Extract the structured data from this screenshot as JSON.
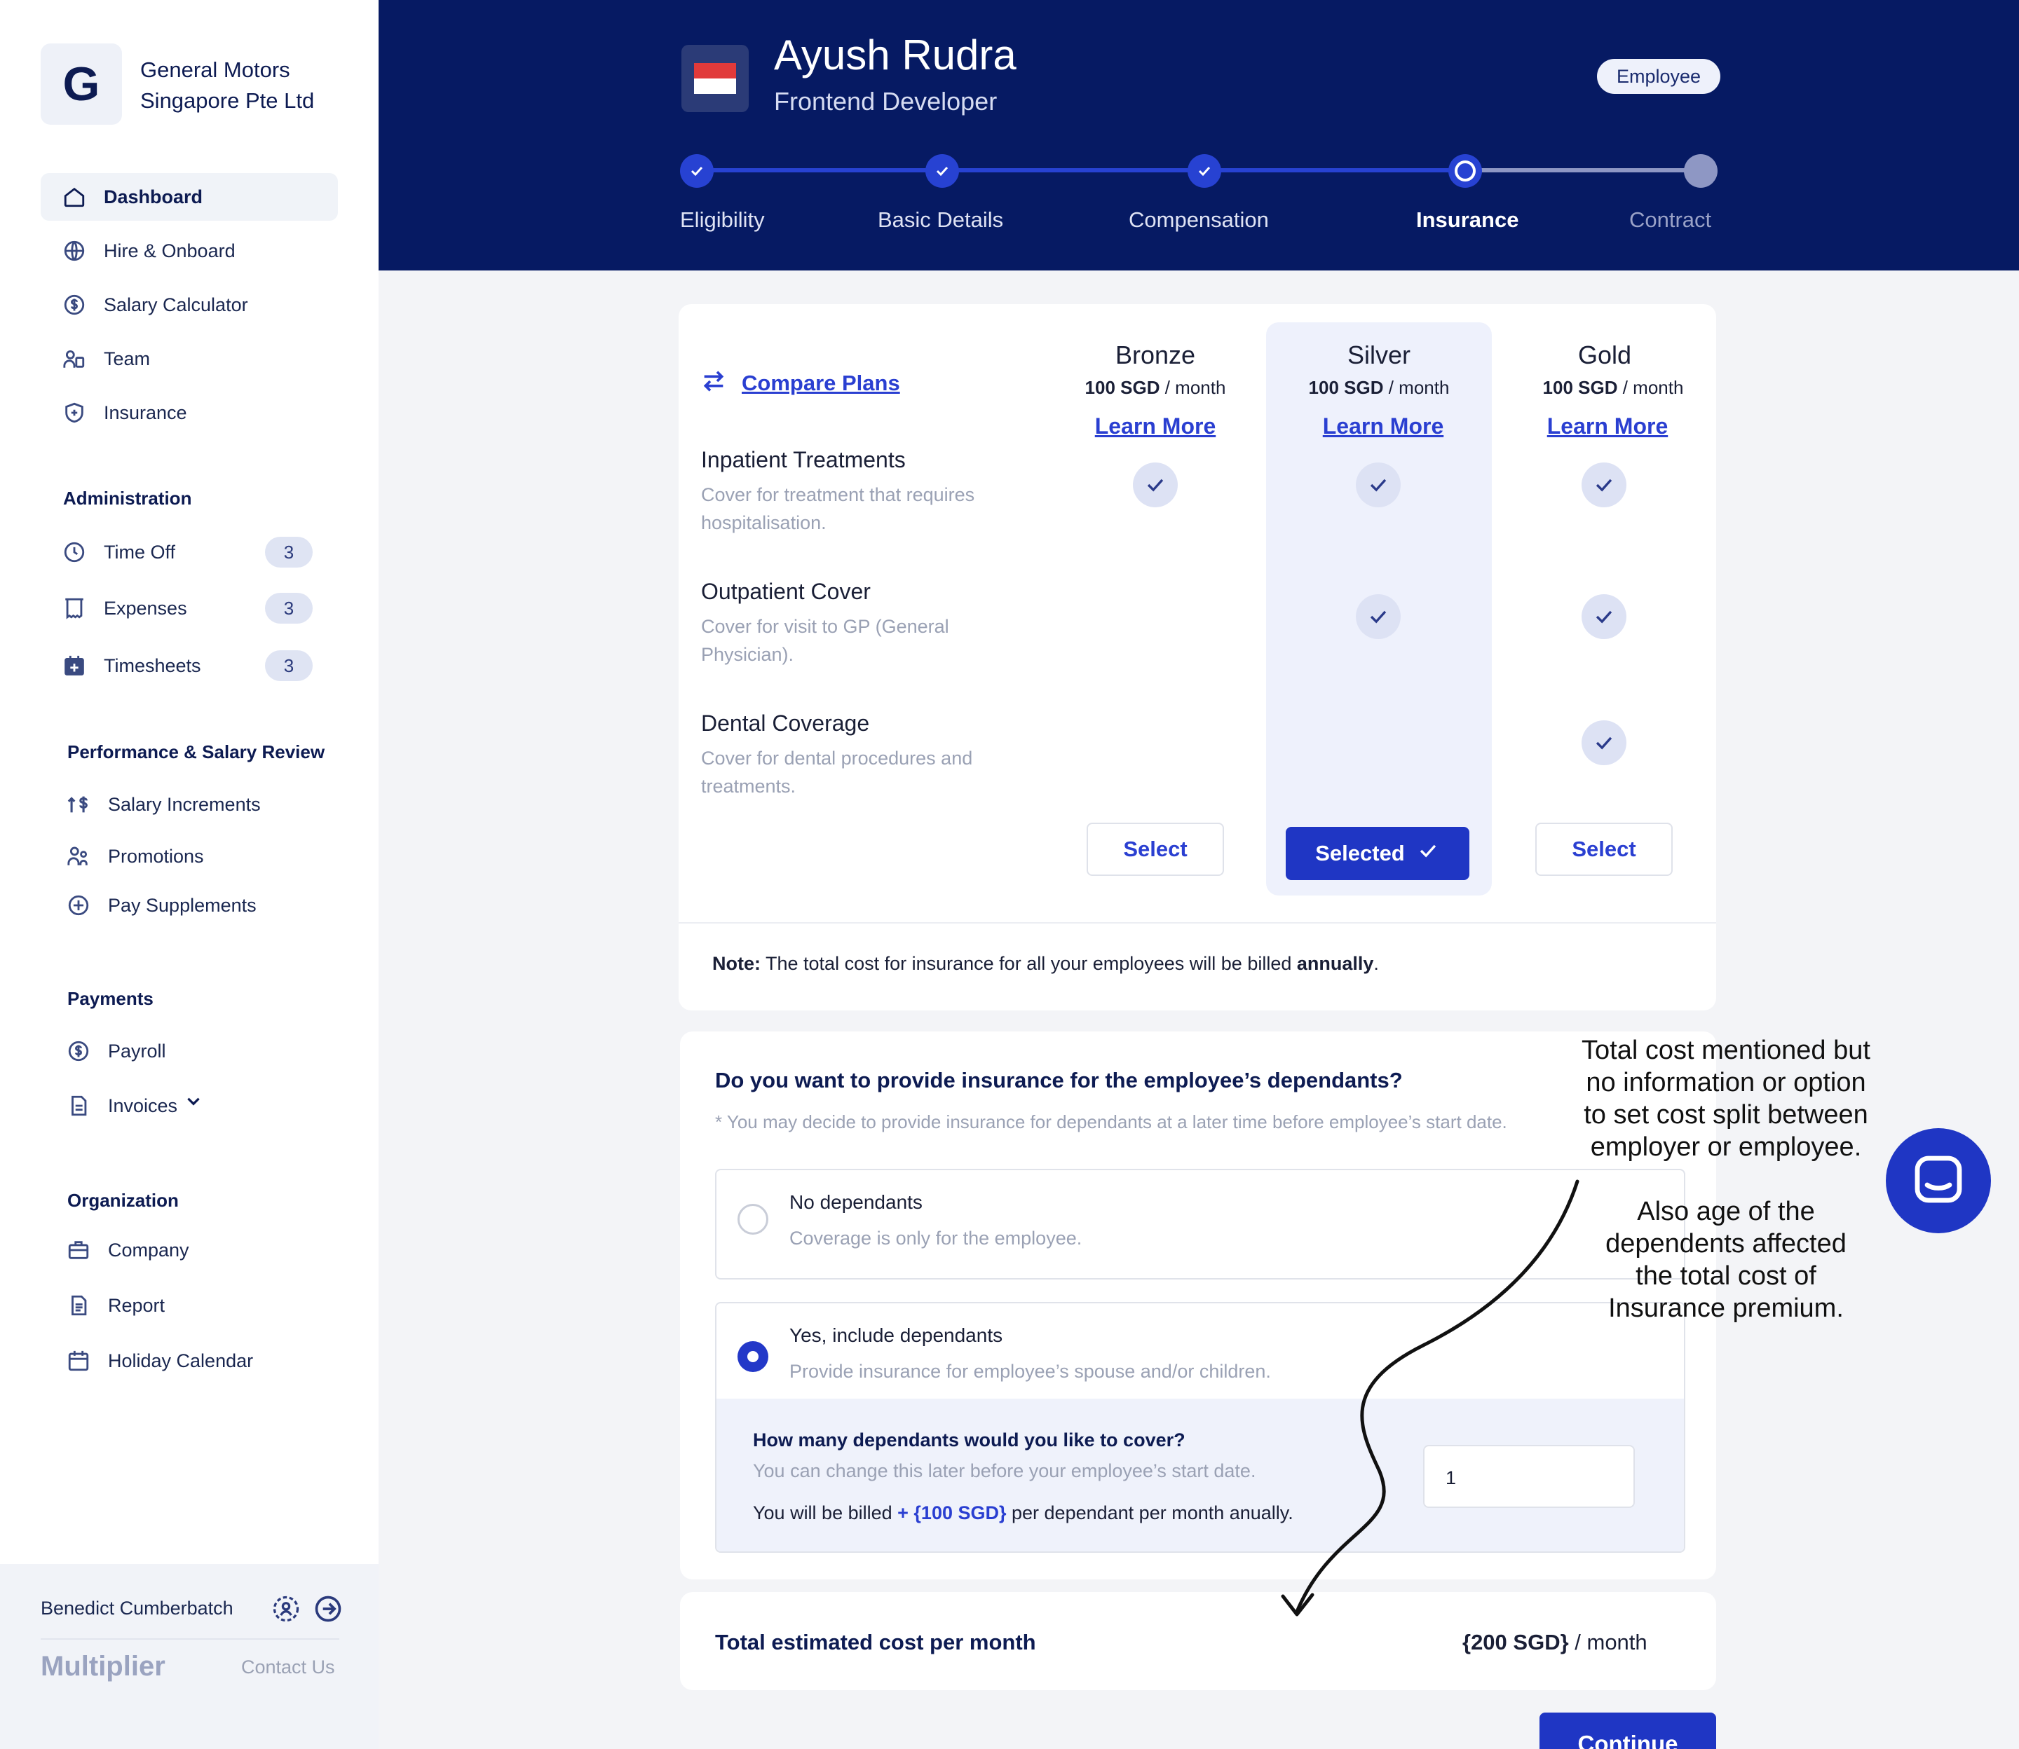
{
  "sidebar": {
    "logo_letter": "G",
    "company_line1": "General Motors",
    "company_line2": "Singapore Pte Ltd",
    "nav_main": [
      {
        "label": "Dashboard"
      },
      {
        "label": "Hire & Onboard"
      },
      {
        "label": "Salary Calculator"
      },
      {
        "label": "Team"
      },
      {
        "label": "Insurance"
      }
    ],
    "admin_heading": "Administration",
    "admin": [
      {
        "label": "Time Off",
        "badge": "3"
      },
      {
        "label": "Expenses",
        "badge": "3"
      },
      {
        "label": "Timesheets",
        "badge": "3"
      }
    ],
    "perf_heading": "Performance & Salary Review",
    "perf": [
      {
        "label": "Salary Increments"
      },
      {
        "label": "Promotions"
      },
      {
        "label": "Pay Supplements"
      }
    ],
    "payments_heading": "Payments",
    "payments": [
      {
        "label": "Payroll"
      },
      {
        "label": "Invoices"
      }
    ],
    "org_heading": "Organization",
    "org": [
      {
        "label": "Company"
      },
      {
        "label": "Report"
      },
      {
        "label": "Holiday Calendar"
      }
    ],
    "user_name": "Benedict Cumberbatch",
    "brand": "Multiplier",
    "contact": "Contact Us"
  },
  "header": {
    "name": "Ayush Rudra",
    "role": "Frontend Developer",
    "badge": "Employee",
    "steps": [
      {
        "label": "Eligibility",
        "state": "done"
      },
      {
        "label": "Basic Details",
        "state": "done"
      },
      {
        "label": "Compensation",
        "state": "done"
      },
      {
        "label": "Insurance",
        "state": "current"
      },
      {
        "label": "Contract",
        "state": "todo"
      }
    ]
  },
  "plans": {
    "compare_label": "Compare Plans",
    "learn_more": "Learn More",
    "items": [
      {
        "name": "Bronze",
        "price": "100 SGD",
        "period": "/ month",
        "button": "Select"
      },
      {
        "name": "Silver",
        "price": "100 SGD",
        "period": "/ month",
        "button": "Selected"
      },
      {
        "name": "Gold",
        "price": "100 SGD",
        "period": "/ month",
        "button": "Select"
      }
    ],
    "features": [
      {
        "title": "Inpatient Treatments",
        "sub": "Cover for treatment that requires hospitalisation."
      },
      {
        "title": "Outpatient Cover",
        "sub": "Cover for visit to GP (General Physician)."
      },
      {
        "title": "Dental Coverage",
        "sub": "Cover for dental procedures and treatments."
      }
    ],
    "note_label": "Note:",
    "note_text": "The total cost for insurance for all your employees will be billed",
    "note_bold": "annually",
    "note_end": "."
  },
  "dependants": {
    "question": "Do you want to provide insurance for the employee’s dependants?",
    "hint": "* You may decide to provide insurance for dependants at a later time before employee’s start date.",
    "option_no_title": "No dependants",
    "option_no_sub": "Coverage is only for the employee.",
    "option_yes_title": "Yes, include dependants",
    "option_yes_sub": "Provide insurance for employee’s spouse and/or children.",
    "count_question": "How many dependants would you like to cover?",
    "count_hint": "You can change this later before your employee’s start date.",
    "billed_prefix": "You will be billed",
    "billed_amount": "+ {100 SGD}",
    "billed_suffix": "per dependant per month anually.",
    "count_value": "1"
  },
  "total": {
    "label": "Total estimated cost per month",
    "amount": "{200 SGD}",
    "period": "/ month"
  },
  "continue_label": "Continue",
  "annotations": {
    "note1": [
      "Total cost mentioned but",
      "no information or option",
      "to set cost split between",
      "employer or employee."
    ],
    "note2": [
      "Also age of the",
      "dependents affected",
      "the total cost of",
      "Insurance premium."
    ]
  }
}
